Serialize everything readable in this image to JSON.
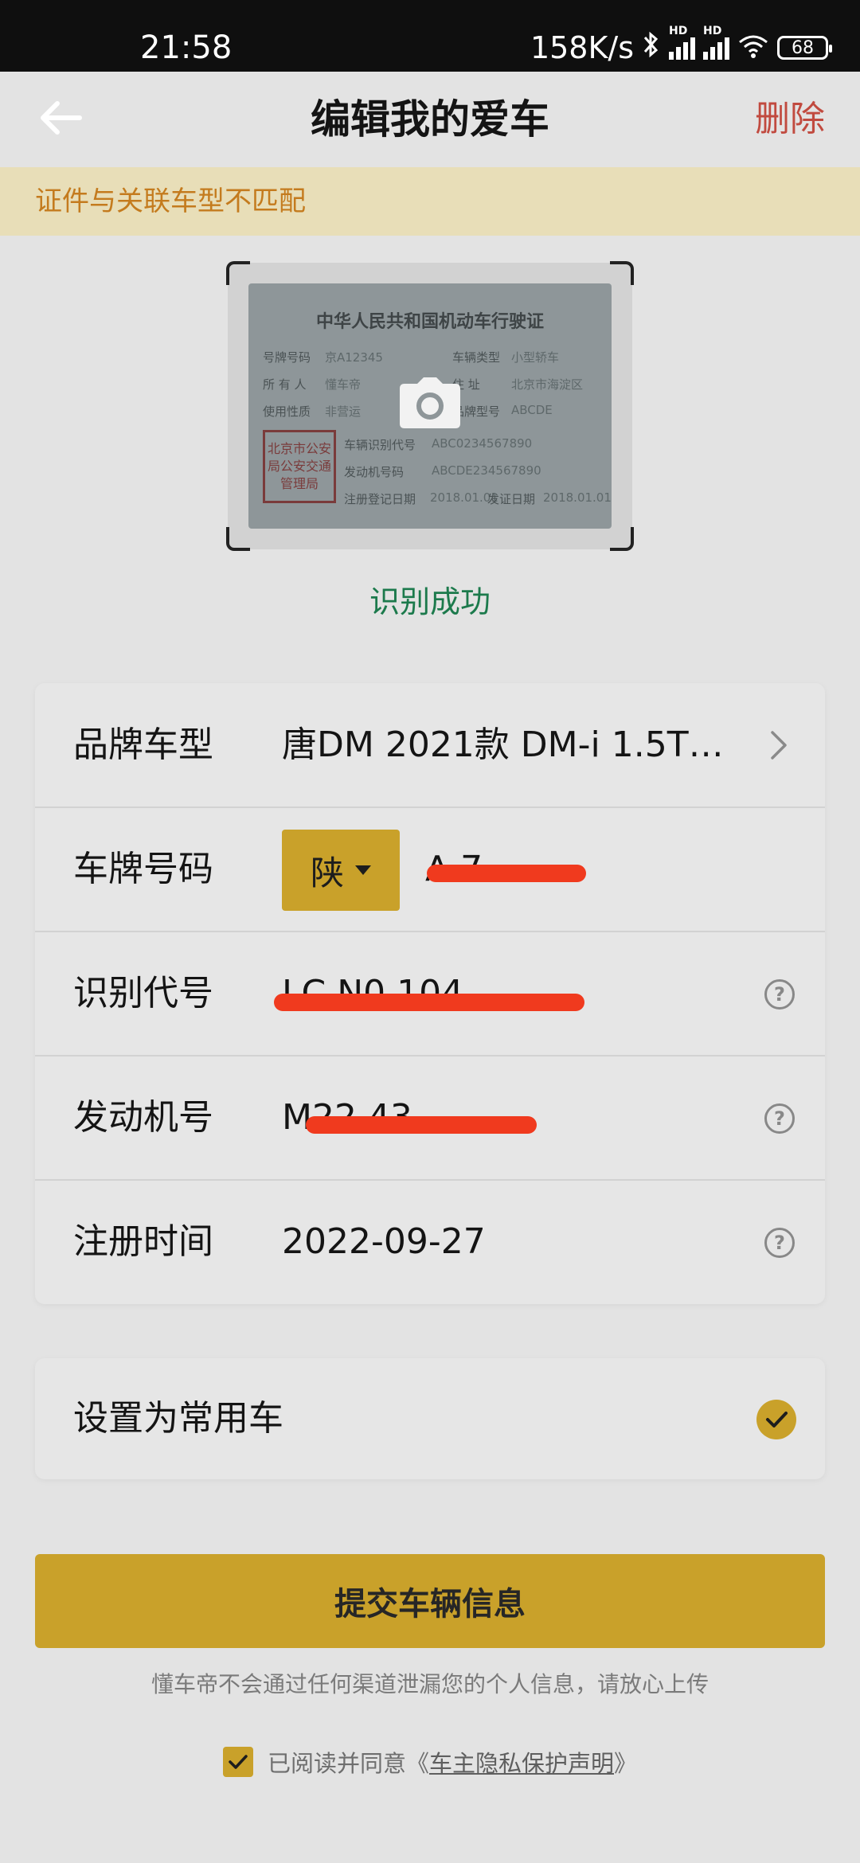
{
  "status_bar": {
    "time": "21:58",
    "net_speed": "158K/s",
    "sig_hd": "HD",
    "battery": "68"
  },
  "header": {
    "title": "编辑我的爱车",
    "delete_label": "删除"
  },
  "warning": {
    "text": "证件与关联车型不匹配"
  },
  "license_card": {
    "heading": "中华人民共和国机动车行驶证",
    "fields": {
      "plate_no_label": "号牌号码",
      "plate_no_value": "京A12345",
      "vehicle_type_label": "车辆类型",
      "vehicle_type_value": "小型轿车",
      "owner_label": "所 有 人",
      "owner_value": "懂车帝",
      "address_label": "住     址",
      "address_value": "北京市海淀区",
      "use_label": "使用性质",
      "use_value": "非营运",
      "model_label": "品牌型号",
      "model_value": "ABCDE",
      "vin_label": "车辆识别代号",
      "vin_value": "ABC0234567890",
      "engine_label": "发动机号码",
      "engine_value": "ABCDE234567890",
      "reg_label": "注册登记日期",
      "reg_value": "2018.01.01",
      "issue_label": "发证日期",
      "issue_value": "2018.01.01"
    },
    "stamp_text": "北京市公安局公安交通管理局"
  },
  "recognition": {
    "status": "识别成功"
  },
  "form": {
    "brand_label": "品牌车型",
    "brand_value": "唐DM 2021款 DM-i 1.5T…",
    "plate_label": "车牌号码",
    "plate_province": "陕",
    "plate_value": "A     7",
    "vin_label": "识别代号",
    "vin_value": "LC        N0     104",
    "engine_label": "发动机号",
    "engine_value": "M22       43",
    "reg_label": "注册时间",
    "reg_value": "2022-09-27"
  },
  "common_car": {
    "label": "设置为常用车",
    "checked": true
  },
  "submit": {
    "label": "提交车辆信息"
  },
  "privacy_note": "懂车帝不会通过任何渠道泄漏您的个人信息，请放心上传",
  "agreement": {
    "prefix": "已阅读并同意《",
    "link": "车主隐私保护声明",
    "suffix": "》",
    "checked": true
  },
  "colors": {
    "accent": "#c9a12a",
    "warning_text": "#c47b1e",
    "delete_red": "#c14a3f",
    "success_green": "#1c7a4c"
  },
  "icons": [
    "back-arrow-icon",
    "camera-icon",
    "chevron-right-icon",
    "help-icon",
    "check-icon",
    "bluetooth-icon",
    "wifi-icon",
    "signal-icon",
    "battery-icon"
  ]
}
